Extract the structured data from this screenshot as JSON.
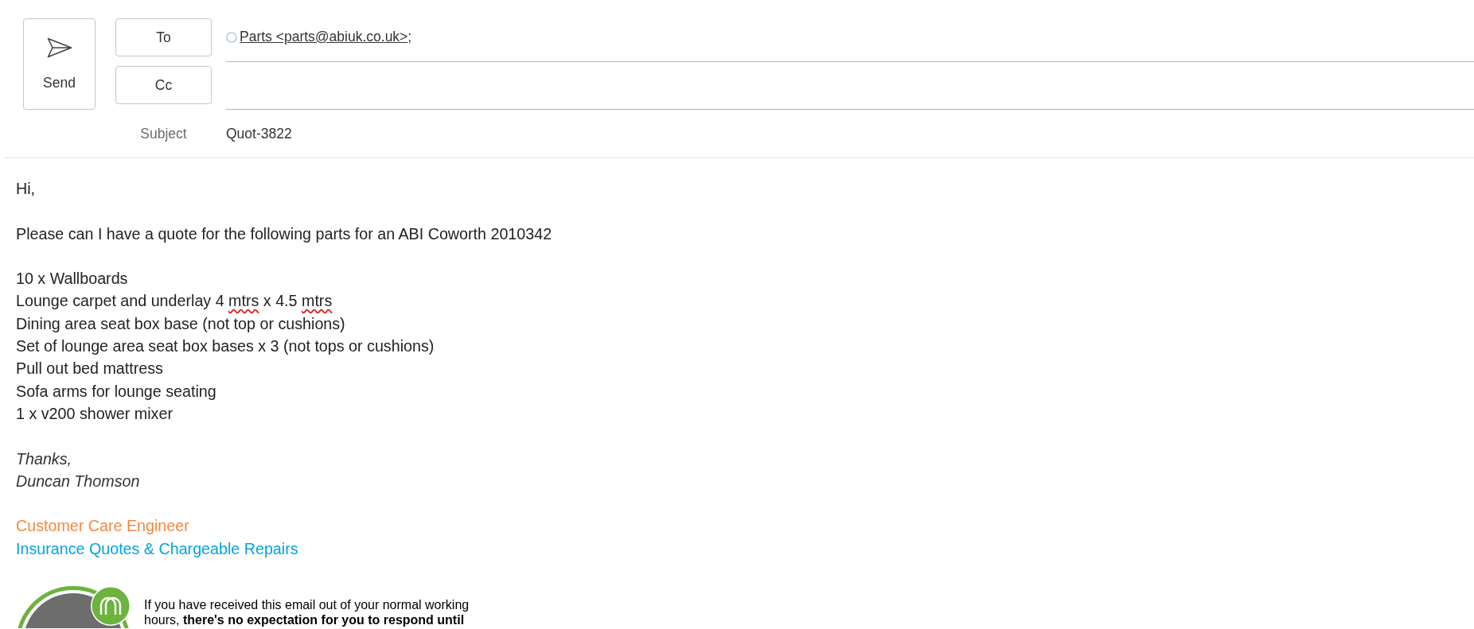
{
  "compose": {
    "send_button": {
      "label": "Send"
    },
    "to": {
      "button": "To",
      "recipients": [
        {
          "name": "Parts <parts@abiuk.co.uk>",
          "separator": ";"
        }
      ]
    },
    "cc": {
      "button": "Cc"
    },
    "subject": {
      "label": "Subject",
      "value": "Quot-3822"
    }
  },
  "body": {
    "greeting": "Hi,",
    "intro": "Please can I have a quote for the following parts for an ABI Coworth 2010342",
    "items": [
      {
        "segments": [
          {
            "text": "10 x Wallboards",
            "misspelled": false
          }
        ]
      },
      {
        "segments": [
          {
            "text": "Lounge carpet and underlay 4 ",
            "misspelled": false
          },
          {
            "text": "mtrs",
            "misspelled": true
          },
          {
            "text": " x 4.5 ",
            "misspelled": false
          },
          {
            "text": "mtrs",
            "misspelled": true
          }
        ]
      },
      {
        "segments": [
          {
            "text": "Dining area seat box base (not top or cushions)",
            "misspelled": false
          }
        ]
      },
      {
        "segments": [
          {
            "text": "Set of lounge area seat box bases x 3 (not tops or cushions)",
            "misspelled": false
          }
        ]
      },
      {
        "segments": [
          {
            "text": "Pull out bed mattress",
            "misspelled": false
          }
        ]
      },
      {
        "segments": [
          {
            "text": "Sofa arms for lounge seating",
            "misspelled": false
          }
        ]
      },
      {
        "segments": [
          {
            "text": "1 x v200 shower mixer",
            "misspelled": false
          }
        ]
      }
    ],
    "closing": "Thanks,",
    "sender": "Duncan Thomson",
    "signature": [
      {
        "text": "Customer Care Engineer",
        "color": "#f5883d"
      },
      {
        "text": "Insurance Quotes & Chargeable Repairs",
        "color": "#00a3e4"
      }
    ],
    "notice": "If you have received this email out of your normal working hours, **there's no expectation for you to respond until**"
  }
}
